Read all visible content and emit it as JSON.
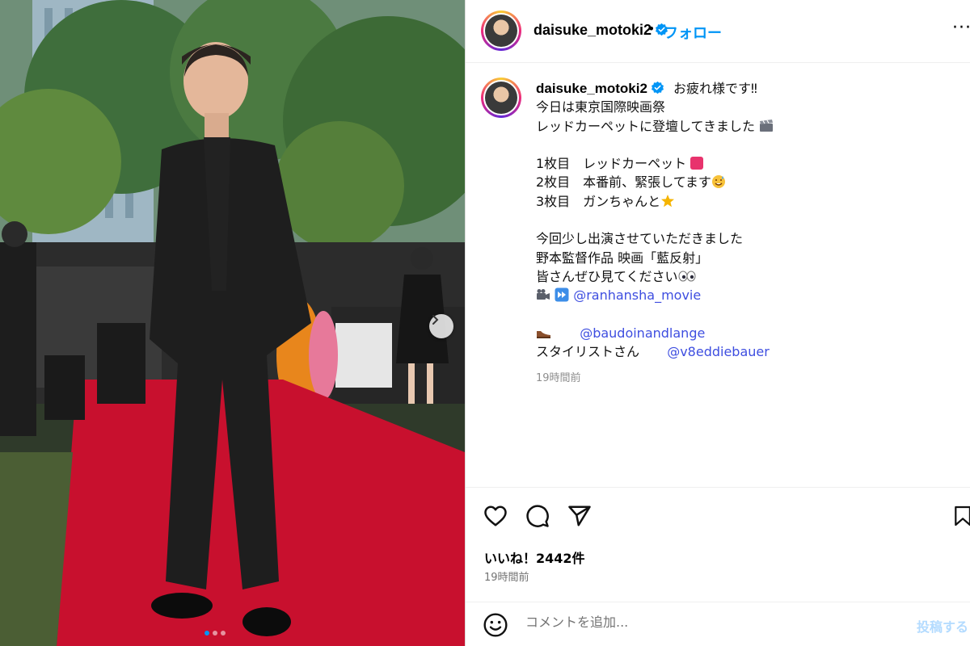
{
  "post": {
    "username": "daisuke_motoki2",
    "separator": "•",
    "follow_label": "フォロー",
    "more_label": "···",
    "carousel": {
      "slides": 3,
      "active": 1
    }
  },
  "caption": {
    "username": "daisuke_motoki2",
    "lines": [
      "お疲れ様です‼",
      "今日は東京国際映画祭",
      "レッドカーペットに登壇してきました",
      "",
      "1枚目　レッドカーペット",
      "2枚目　本番前、緊張してます",
      "3枚目　ガンちゃんと",
      "",
      "今回少し出演させていただきました",
      "野本監督作品 映画「藍反射」",
      "皆さんぜひ見てください"
    ],
    "mention_movie": "@ranhansha_movie",
    "mention_shoes": "@baudoinandlange",
    "stylist_label": "スタイリストさん",
    "mention_stylist": "@v8eddiebauer",
    "time": "19時間前"
  },
  "actions": {
    "likes": "いいね！2442件",
    "time": "19時間前"
  },
  "comment": {
    "placeholder": "コメントを追加...",
    "post_label": "投稿する"
  },
  "colors": {
    "accent": "#0095f6",
    "mention": "#3e4ee0",
    "verified": "#0095f6",
    "carpet": "#c8102e"
  }
}
